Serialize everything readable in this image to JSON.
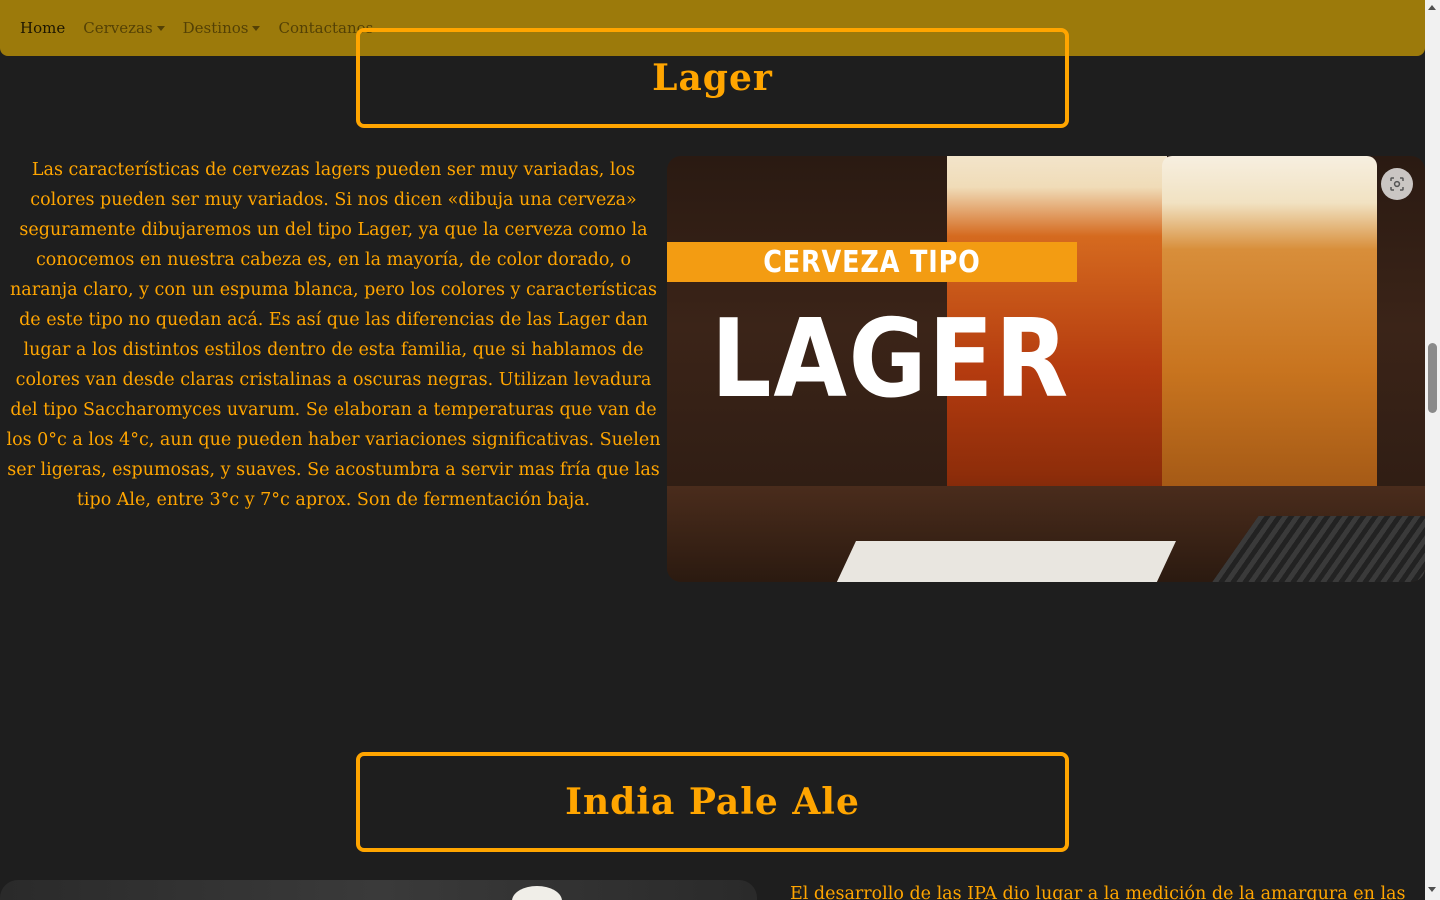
{
  "nav": {
    "home": "Home",
    "cervezas": "Cervezas",
    "destinos": "Destinos",
    "contactanos": "Contactanos"
  },
  "lager": {
    "title": "Lager",
    "description": "Las características de cervezas lagers pueden ser muy variadas, los colores pueden ser muy variados. Si nos dicen «dibuja una cerveza» seguramente dibujaremos un del tipo Lager, ya que la cerveza como la conocemos en nuestra cabeza es, en la mayoría, de color dorado, o naranja claro, y con un espuma blanca, pero los colores y características de este tipo no quedan acá. Es así que las diferencias de las Lager dan lugar a los distintos estilos dentro de esta familia, que si hablamos de colores van desde claras cristalinas a oscuras negras. Utilizan levadura del tipo Saccharomyces uvarum. Se elaboran a temperaturas que van de los 0°c a los 4°c, aun que pueden haber variaciones significativas. Suelen ser ligeras, espumosas, y suaves. Se acostumbra a servir mas fría que las tipo Ale, entre 3°c y 7°c aprox. Son de fermentación baja.",
    "image_banner_top": "CERVEZA TIPO",
    "image_banner_big": "LAGER"
  },
  "ipa": {
    "title": "India Pale Ale",
    "description_start": "El desarrollo de las IPA dio lugar a la medición de la amargura en las"
  },
  "colors": {
    "accent": "#ffa500",
    "navbar": "#9c7a0b",
    "background": "#1e1e1e"
  },
  "icons": {
    "lens": "visual-search-icon"
  }
}
